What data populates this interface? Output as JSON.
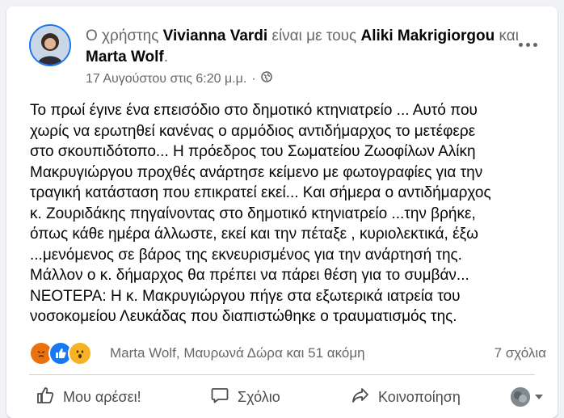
{
  "post": {
    "header": {
      "prefix": "Ο χρήστης ",
      "author": "Vivianna Vardi",
      "with_text": " είναι με τους ",
      "tagged_1": "Aliki Makrigiorgou",
      "and_text": " και ",
      "tagged_2": "Marta Wolf",
      "end": "."
    },
    "timestamp": "17 Αυγούστου στις 6:20 μ.μ.",
    "separator": "·",
    "body": "Το πρωί έγινε ένα επεισόδιο στο δημοτικό κτηνιατρείο ... Αυτό που\nχωρίς να ερωτηθεί κανένας ο αρμόδιος αντιδήμαρχος το μετέφερε\nστο σκουπιδότοπο... Η πρόεδρος του Σωματείου Ζωοφίλων Αλίκη\nΜακρυγιώργου προχθές ανάρτησε κείμενο με φωτογραφίες για την\nτραγική κατάσταση που επικρατεί εκεί... Και σήμερα ο αντιδήμαρχος\nκ. Ζουριδάκης πηγαίνοντας στο δημοτικό κτηνιατρείο  ...την βρήκε,\nόπως κάθε ημέρα άλλωστε, εκεί και την πέταξε , κυριολεκτικά, έξω\n...μενόμενος σε βάρος της εκνευρισμένος για την ανάρτησή της.\nΜάλλον ο κ. δήμαρχος θα πρέπει να πάρει θέση για το συμβάν...\nΝΕΟΤΕΡΑ: Η κ. Μακρυγιώργου πήγε στα εξωτερικά ιατρεία του\nνοσοκομείου Λευκάδας που διαπιστώθηκε ο τραυματισμός της.",
    "reactions_text": "Marta Wolf, Μαυρωνά Δώρα και 51 ακόμη",
    "comments_count": "7 σχόλια"
  },
  "actions": {
    "like": "Μου αρέσει!",
    "comment": "Σχόλιο",
    "share": "Κοινοποίηση"
  },
  "icons": [
    "more-options-icon",
    "globe-icon",
    "angry-reaction-icon",
    "like-reaction-icon",
    "wow-reaction-icon",
    "like-icon",
    "comment-icon",
    "share-icon",
    "caret-down-icon"
  ],
  "colors": {
    "brand": "#1877f2",
    "text": "#050505",
    "secondary": "#65676b",
    "angry": "#e9710f",
    "wow": "#f7b125"
  }
}
